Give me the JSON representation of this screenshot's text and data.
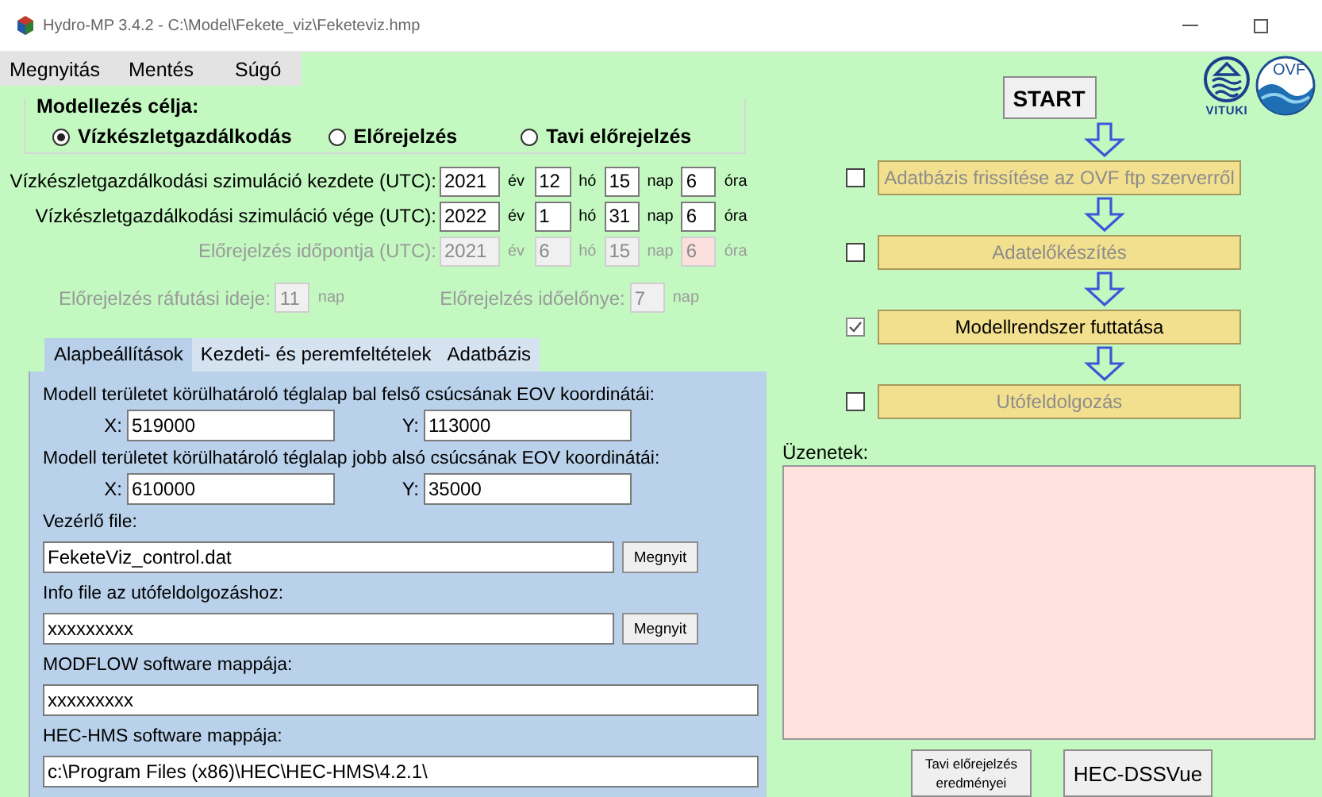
{
  "window": {
    "title": "Hydro-MP 3.4.2 - C:\\Model\\Fekete_viz\\Feketeviz.hmp"
  },
  "menu": [
    {
      "label": "Megnyitás"
    },
    {
      "label": "Mentés"
    },
    {
      "label": "Súgó"
    }
  ],
  "purpose": {
    "title": "Modellezés célja:",
    "options": [
      {
        "label": "Vízkészletgazdálkodás",
        "selected": true
      },
      {
        "label": "Előrejelzés",
        "selected": false
      },
      {
        "label": "Tavi előrejelzés",
        "selected": false
      }
    ]
  },
  "date_rows": [
    {
      "label": "Vízkészletgazdálkodási szimuláció kezdete (UTC):",
      "disabled": false,
      "fields": [
        {
          "value": "2021",
          "unit": "év",
          "highlighted": false
        },
        {
          "value": "12",
          "unit": "hó",
          "highlighted": false
        },
        {
          "value": "15",
          "unit": "nap",
          "highlighted": false
        },
        {
          "value": "6",
          "unit": "óra",
          "highlighted": false
        }
      ]
    },
    {
      "label": "Vízkészletgazdálkodási szimuláció vége (UTC):",
      "disabled": false,
      "fields": [
        {
          "value": "2022",
          "unit": "év",
          "highlighted": false
        },
        {
          "value": "1",
          "unit": "hó",
          "highlighted": false
        },
        {
          "value": "31",
          "unit": "nap",
          "highlighted": false
        },
        {
          "value": "6",
          "unit": "óra",
          "highlighted": false
        }
      ]
    },
    {
      "label": "Előrejelzés időpontja (UTC):",
      "disabled": true,
      "fields": [
        {
          "value": "2021",
          "unit": "év",
          "highlighted": false
        },
        {
          "value": "6",
          "unit": "hó",
          "highlighted": false
        },
        {
          "value": "15",
          "unit": "nap",
          "highlighted": false
        },
        {
          "value": "6",
          "unit": "óra",
          "highlighted": true
        }
      ]
    }
  ],
  "forecast_params": [
    {
      "label": "Előrejelzés ráfutási ideje:",
      "value": "11",
      "unit": "nap",
      "disabled": true
    },
    {
      "label": "Előrejelzés időelőnye:",
      "value": "7",
      "unit": "nap",
      "disabled": true
    }
  ],
  "tabs": [
    {
      "label": "Alapbeállítások",
      "selected": true
    },
    {
      "label": "Kezdeti- és peremfeltételek",
      "selected": false
    },
    {
      "label": "Adatbázis",
      "selected": false
    }
  ],
  "coordinates": [
    {
      "label": "Modell területet körülhatároló téglalap bal felső csúcsának EOV koordinátái:",
      "x_label": "X:",
      "x_value": "519000",
      "y_label": "Y:",
      "y_value": "113000"
    },
    {
      "label": "Modell területet körülhatároló téglalap jobb alsó csúcsának EOV koordinátái:",
      "x_label": "X:",
      "x_value": "610000",
      "y_label": "Y:",
      "y_value": "35000"
    }
  ],
  "files": [
    {
      "label": "Vezérlő file:",
      "value": "FeketeViz_control.dat",
      "button": "Megnyit"
    },
    {
      "label": "Info file az utófeldolgozáshoz:",
      "value": "xxxxxxxxx",
      "button": "Megnyit"
    },
    {
      "label": "MODFLOW software mappája:",
      "value": "xxxxxxxxx"
    },
    {
      "label": "HEC-HMS software mappája:",
      "value": "c:\\Program Files (x86)\\HEC\\HEC-HMS\\4.2.1\\"
    }
  ],
  "start_button": "START",
  "logos": [
    {
      "text": "VITUKI",
      "kind": "vituki"
    },
    {
      "text": "OVF",
      "kind": "ovf"
    }
  ],
  "steps": [
    {
      "label": "Adatbázis frissítése az OVF ftp szerverről",
      "checked": false,
      "disabled": true
    },
    {
      "label": "Adatelőkészítés",
      "checked": false,
      "disabled": true
    },
    {
      "label": "Modellrendszer futtatása",
      "checked": true,
      "disabled": false
    },
    {
      "label": "Utófeldolgozás",
      "checked": false,
      "disabled": true
    }
  ],
  "messages": {
    "label": "Üzenetek:"
  },
  "bottom_buttons": [
    {
      "label": "Tavi előrejelzés eredményei",
      "kind": "small"
    },
    {
      "label": "HEC-DSSVue",
      "kind": "large"
    }
  ]
}
